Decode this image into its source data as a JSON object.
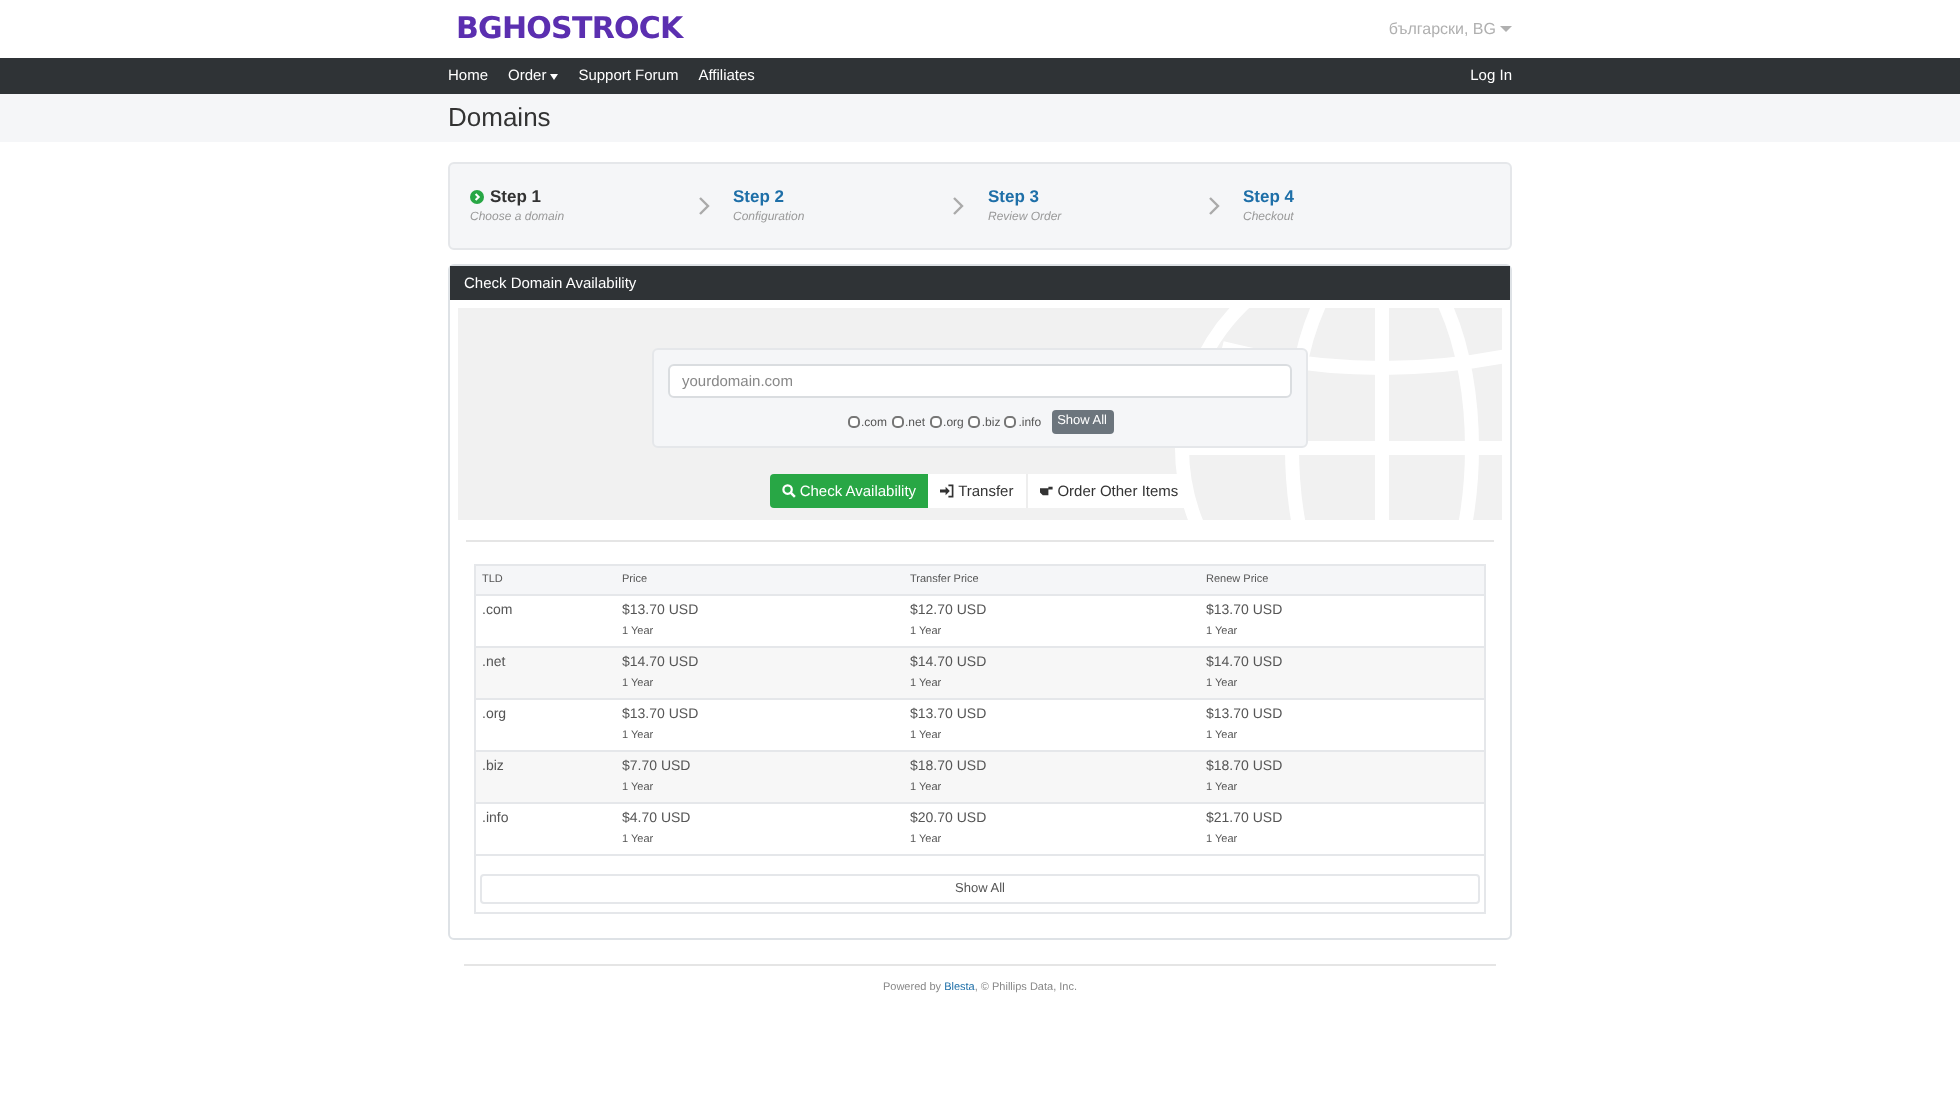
{
  "header": {
    "logo": "BGHOSTROCK",
    "language": "български, BG"
  },
  "nav": {
    "items": [
      {
        "label": "Home",
        "dropdown": false
      },
      {
        "label": "Order",
        "dropdown": true
      },
      {
        "label": "Support Forum",
        "dropdown": false
      },
      {
        "label": "Affiliates",
        "dropdown": false
      }
    ],
    "login": "Log In"
  },
  "page_title": "Domains",
  "steps": [
    {
      "title": "Step 1",
      "subtitle": "Choose a domain",
      "current": true
    },
    {
      "title": "Step 2",
      "subtitle": "Configuration",
      "current": false
    },
    {
      "title": "Step 3",
      "subtitle": "Review Order",
      "current": false
    },
    {
      "title": "Step 4",
      "subtitle": "Checkout",
      "current": false
    }
  ],
  "panel": {
    "title": "Check Domain Availability",
    "search": {
      "placeholder": "yourdomain.com"
    },
    "tlds": [
      {
        "label": ".com",
        "checked": false
      },
      {
        "label": ".net",
        "checked": false
      },
      {
        "label": ".org",
        "checked": false
      },
      {
        "label": ".biz",
        "checked": false
      },
      {
        "label": ".info",
        "checked": false
      }
    ],
    "show_all_tlds": "Show All",
    "actions": [
      {
        "label": "Check Availability",
        "kind": "primary"
      },
      {
        "label": "Transfer",
        "kind": "transfer"
      },
      {
        "label": "Order Other Items",
        "kind": "other"
      }
    ]
  },
  "table": {
    "columns": [
      "TLD",
      "Price",
      "Transfer Price",
      "Renew Price"
    ],
    "rows": [
      {
        "cells": [
          {
            "tld": ".com"
          },
          {
            "price": "$13.70 USD",
            "term": "1 Year"
          },
          {
            "price": "$12.70 USD",
            "term": "1 Year"
          },
          {
            "price": "$13.70 USD",
            "term": "1 Year"
          }
        ]
      },
      {
        "cells": [
          {
            "tld": ".net"
          },
          {
            "price": "$14.70 USD",
            "term": "1 Year"
          },
          {
            "price": "$14.70 USD",
            "term": "1 Year"
          },
          {
            "price": "$14.70 USD",
            "term": "1 Year"
          }
        ]
      },
      {
        "cells": [
          {
            "tld": ".org"
          },
          {
            "price": "$13.70 USD",
            "term": "1 Year"
          },
          {
            "price": "$13.70 USD",
            "term": "1 Year"
          },
          {
            "price": "$13.70 USD",
            "term": "1 Year"
          }
        ]
      },
      {
        "cells": [
          {
            "tld": ".biz"
          },
          {
            "price": "$7.70 USD",
            "term": "1 Year"
          },
          {
            "price": "$18.70 USD",
            "term": "1 Year"
          },
          {
            "price": "$18.70 USD",
            "term": "1 Year"
          }
        ]
      },
      {
        "cells": [
          {
            "tld": ".info"
          },
          {
            "price": "$4.70 USD",
            "term": "1 Year"
          },
          {
            "price": "$20.70 USD",
            "term": "1 Year"
          },
          {
            "price": "$21.70 USD",
            "term": "1 Year"
          }
        ]
      }
    ],
    "show_all": "Show All"
  },
  "footer": {
    "prefix": "Powered by ",
    "link": "Blesta",
    "suffix": ", © Phillips Data, Inc."
  }
}
